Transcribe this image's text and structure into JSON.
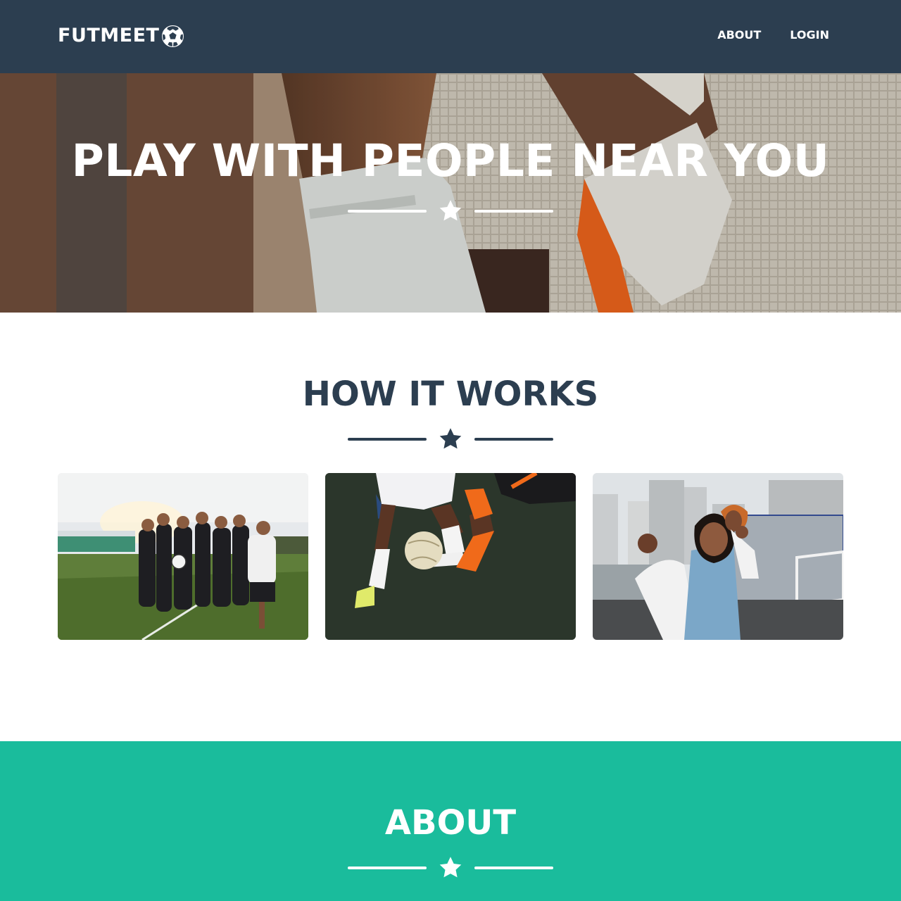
{
  "navbar": {
    "brand": "FUTMEET",
    "brand_icon": "soccer-ball-icon",
    "links": [
      {
        "label": "ABOUT"
      },
      {
        "label": "LOGIN"
      }
    ]
  },
  "hero": {
    "title": "PLAY WITH PEOPLE NEAR YOU",
    "divider_icon": "star-icon"
  },
  "how_it_works": {
    "title": "HOW IT WORKS",
    "divider_icon": "star-icon",
    "cards": [
      {
        "image": "team-celebrating-photo"
      },
      {
        "image": "players-dribbling-photo"
      },
      {
        "image": "women-celebrating-photo"
      }
    ]
  },
  "about": {
    "title": "ABOUT",
    "divider_icon": "star-icon"
  },
  "colors": {
    "navbar": "#2c3e50",
    "heading": "#2c3e50",
    "accent": "#1abc9c",
    "white": "#ffffff"
  }
}
